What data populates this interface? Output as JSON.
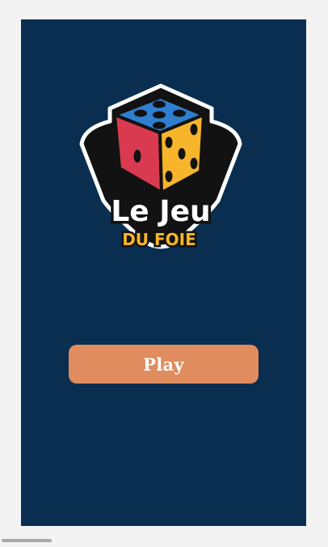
{
  "logo": {
    "line1": "Le Jeu",
    "line2": "DU FOIE",
    "icon": "dice-icon"
  },
  "play_button": {
    "label": "Play"
  },
  "colors": {
    "background": "#0a2e4f",
    "button": "#e08c5f",
    "dice_top": "#2f7fd0",
    "dice_left": "#d93a4f",
    "dice_right": "#f6b52a",
    "logo_accent": "#f6b52a"
  }
}
